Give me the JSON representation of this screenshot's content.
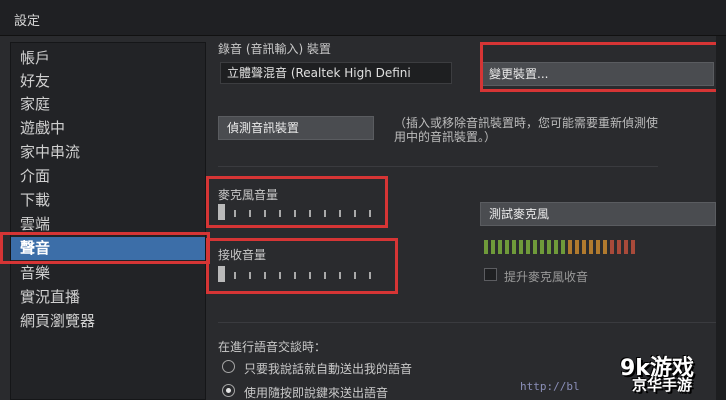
{
  "window": {
    "title": "設定",
    "top_residue": ""
  },
  "sidebar": {
    "items": [
      {
        "label": "帳戶"
      },
      {
        "label": "好友"
      },
      {
        "label": "家庭"
      },
      {
        "label": "遊戲中"
      },
      {
        "label": "家中串流"
      },
      {
        "label": "介面"
      },
      {
        "label": "下載"
      },
      {
        "label": "雲端"
      },
      {
        "label": "聲音",
        "active": true
      },
      {
        "label": "音樂"
      },
      {
        "label": "實況直播"
      },
      {
        "label": "網頁瀏覽器"
      }
    ]
  },
  "audio": {
    "recording_label": "錄音 (音訊輸入) 裝置",
    "device_value": "立體聲混音 (Realtek High Defini",
    "change_device_button": "變更裝置...",
    "detect_button": "偵測音訊裝置",
    "detect_note": "（插入或移除音訊裝置時，您可能需要重新偵測使用中的音訊裝置。）",
    "mic_volume_label": "麥克風音量",
    "receive_volume_label": "接收音量",
    "test_mic_button": "測試麥克風",
    "boost_mic_label": "提升麥克風收音",
    "mic_volume_level": 0.0,
    "receive_volume_level": 0.0,
    "voice_section_label": "在進行語音交談時：",
    "voice_options": [
      {
        "label": "只要我說話就自動送出我的語音",
        "checked": false
      },
      {
        "label": "使用隨按即說鍵來送出語音",
        "checked": true
      }
    ]
  },
  "colors": {
    "accent": "#3c6ea8",
    "highlight": "#d63535",
    "meter_green": "#6f9a3a",
    "meter_orange": "#b07a2e",
    "meter_red": "#a84a3a"
  },
  "watermark": {
    "url": "http://bl",
    "logo_line1": "9k游戏",
    "logo_line2": "京华手游"
  }
}
